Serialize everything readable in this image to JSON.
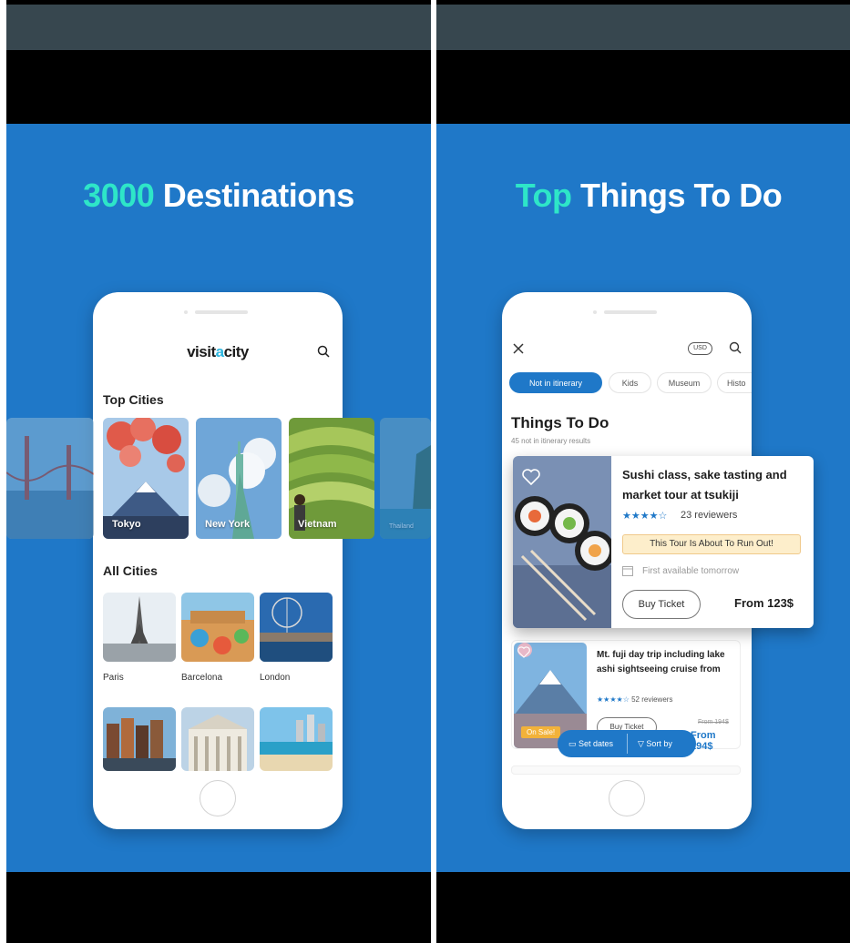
{
  "left_panel": {
    "headline_accent": "3000",
    "headline_rest": " Destinations",
    "logo": {
      "pre": "visit",
      "accent": "a",
      "post": "city"
    },
    "top_cities_title": "Top Cities",
    "top_cities": [
      "Tokyo",
      "New York",
      "Vietnam",
      "Thailand"
    ],
    "all_cities_title": "All Cities",
    "all_cities": [
      "Paris",
      "Barcelona",
      "London"
    ]
  },
  "right_panel": {
    "headline_accent": "Top",
    "headline_rest": " Things To Do",
    "currency": "USD",
    "filters": [
      "Not in itinerary",
      "Kids",
      "Museum",
      "Histo"
    ],
    "section_title": "Things To Do",
    "section_subtitle": "45 not in itinerary results",
    "featured": {
      "title": "Sushi class, sake tasting and market tour at tsukiji",
      "stars": "★★★★☆",
      "reviews": "23 reviewers",
      "alert": "This Tour Is About To Run Out!",
      "availability": "First available tomorrow",
      "buy_label": "Buy Ticket",
      "price": "From 123$"
    },
    "second": {
      "title": "Mt. fuji day trip including lake ashi sightseeing cruise from",
      "stars": "★★★★☆",
      "reviews": "52 reviewers",
      "sale_badge": "On Sale!",
      "buy_label": "Buy Ticket",
      "old_price": "From 194$",
      "new_price": "From 194$"
    },
    "set_dates": "Set dates",
    "sort_by": "Sort by"
  },
  "colors": {
    "accent_teal": "#2ee6c8",
    "blue": "#1f78c8",
    "topbar": "#37474f"
  }
}
